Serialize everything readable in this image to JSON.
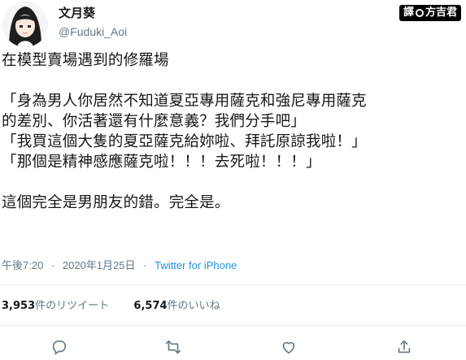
{
  "user": {
    "display_name": "文月葵",
    "handle": "@Fuduki_Aoi"
  },
  "translator_badge": {
    "prefix": "譯",
    "name": "方吉君"
  },
  "tweet": {
    "text": "在模型賣場遇到的修羅場\n\n「身為男人你居然不知道夏亞專用薩克和強尼專用薩克\n的差別、你活著還有什麼意義？我們分手吧」\n「我買這個大隻的夏亞薩克給妳啦、拜託原諒我啦！」\n「那個是精神感應薩克啦！！！去死啦！！！」\n\n這個完全是男朋友的錯。完全是。"
  },
  "meta": {
    "time": "午後7:20",
    "date": "2020年1月25日",
    "separator": "·",
    "source": "Twitter for iPhone"
  },
  "stats": {
    "retweets_count": "3,953",
    "retweets_label": "件のリツイート",
    "likes_count": "6,574",
    "likes_label": "件のいいね"
  },
  "actions": {
    "icons": [
      "reply-icon",
      "retweet-icon",
      "like-icon",
      "share-icon"
    ]
  },
  "colors": {
    "text": "#14171a",
    "muted": "#657786",
    "link": "#1b95e0",
    "divider": "#e6ecf0"
  }
}
